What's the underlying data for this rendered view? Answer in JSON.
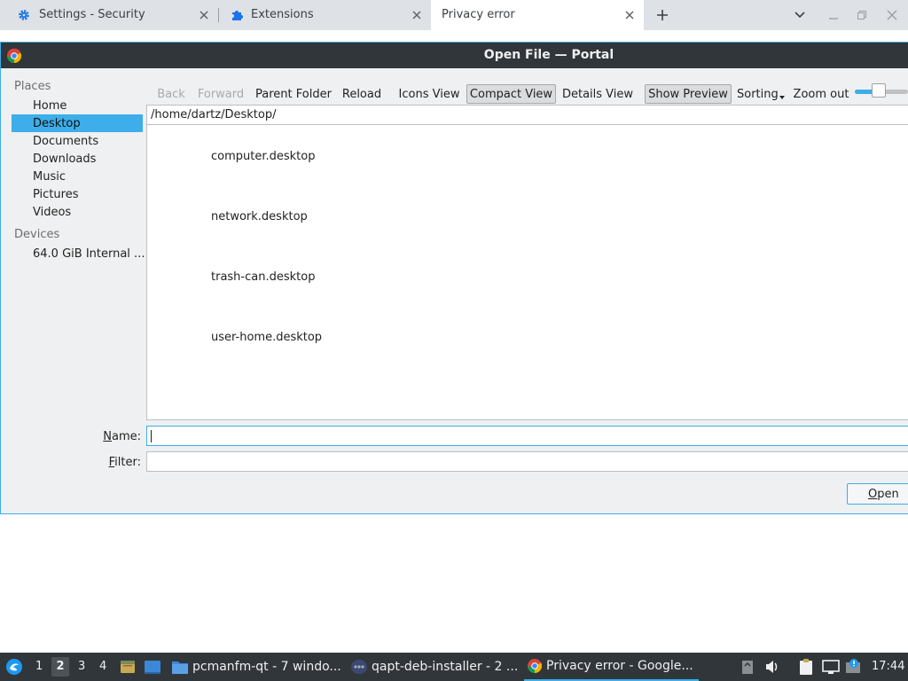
{
  "browser": {
    "tabs": [
      {
        "label": "Settings - Security",
        "icon": "gear-icon",
        "active": false
      },
      {
        "label": "Extensions",
        "icon": "puzzle-icon",
        "active": false
      },
      {
        "label": "Privacy error",
        "icon": "",
        "active": true
      }
    ],
    "new_tab_icon": "plus-icon",
    "window_controls": [
      "chevron-down-icon",
      "minimize-icon",
      "restore-icon",
      "close-icon"
    ]
  },
  "dialog": {
    "title": "Open File — Portal",
    "places_header": "Places",
    "places": [
      "Home",
      "Desktop",
      "Documents",
      "Downloads",
      "Music",
      "Pictures",
      "Videos"
    ],
    "selected_place": "Desktop",
    "devices_header": "Devices",
    "devices": [
      "64.0 GiB Internal ..."
    ],
    "toolbar": {
      "back": "Back",
      "forward": "Forward",
      "parent_folder": "Parent Folder",
      "reload": "Reload",
      "icons_view": "Icons View",
      "compact_view": "Compact View",
      "details_view": "Details View",
      "show_preview": "Show Preview",
      "sorting": "Sorting",
      "zoom_out": "Zoom out",
      "zoom_level": 0.45
    },
    "path": "/home/dartz/Desktop/",
    "files": [
      "computer.desktop",
      "network.desktop",
      "trash-can.desktop",
      "user-home.desktop"
    ],
    "name_label": "Name:",
    "name_mnemonic": "N",
    "name_rest": "ame:",
    "name_value": "",
    "filter_label": "Filter:",
    "filter_mnemonic": "F",
    "filter_rest": "ilter:",
    "filter_value": "",
    "open_button": "Open",
    "open_mnemonic": "O",
    "open_rest": "pen"
  },
  "taskbar": {
    "workspaces": [
      "1",
      "2",
      "3",
      "4"
    ],
    "active_workspace": "2",
    "tasks": [
      {
        "label": "pcmanfm-qt - 7 windo...",
        "icon": "folder-icon"
      },
      {
        "label": "qapt-deb-installer - 2 ...",
        "icon": "package-icon"
      },
      {
        "label": "Privacy error - Google...",
        "icon": "chrome-icon",
        "active": true
      }
    ],
    "clock": "17:44"
  },
  "colors": {
    "accent": "#3daee9",
    "titlebar": "#31363b",
    "dialog_bg": "#eff0f1",
    "tabstrip": "#dee1e6"
  }
}
